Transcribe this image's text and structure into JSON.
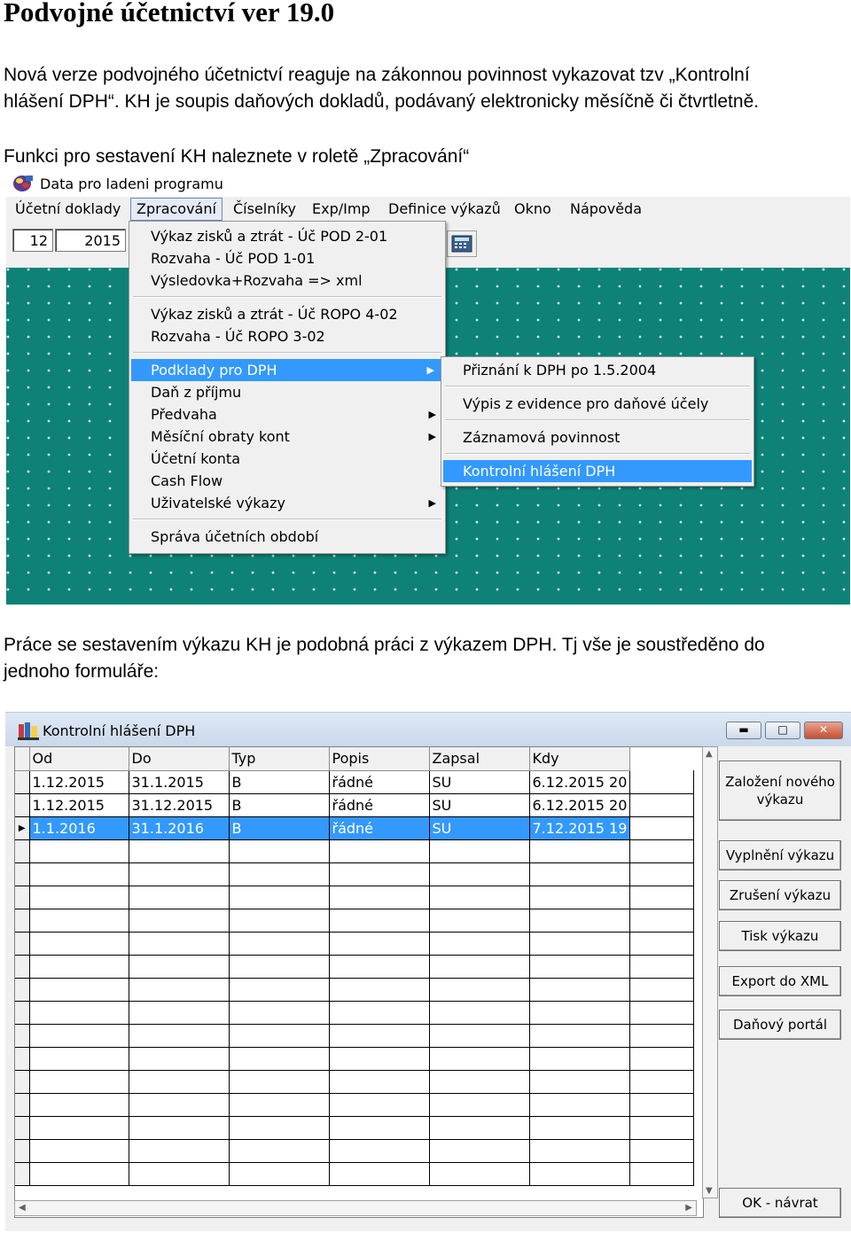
{
  "heading": "Podvojné účetnictví ver 19.0",
  "intro_line1": "Nová verze podvojného účetnictví reaguje na zákonnou povinnost vykazovat tzv „Kontrolní",
  "intro_line2": "hlášení DPH“. KH je soupis daňových dokladů, podávaný elektronicky měsíčně či čtvrtletně.",
  "menu_hint": "Funkci pro sestavení KH naleznete v roletě „Zpracování“",
  "work_line1": "Práce se sestavením výkazu KH je podobná práci z výkazem DPH. Tj vše je soustředěno do",
  "work_line2": "jednoho formuláře:",
  "app": {
    "title": "Data pro ladeni programu",
    "menubar": [
      "Účetní doklady",
      "Zpracování",
      "Číselníky",
      "Exp/Imp",
      "Definice výkazů",
      "Okno",
      "Nápověda"
    ],
    "month": "12",
    "year": "2015",
    "dropdown": [
      "Výkaz zisků a ztrát - Úč POD 2-01",
      "Rozvaha - Úč POD 1-01",
      "Výsledovka+Rozvaha => xml",
      "Výkaz zisků a ztrát - Úč ROPO 4-02",
      "Rozvaha - Úč ROPO 3-02",
      "Podklady pro DPH",
      "Daň z příjmu",
      "Předvaha",
      "Měsíční obraty kont",
      "Účetní konta",
      "Cash Flow",
      "Uživatelské výkazy",
      "Správa účetních období"
    ],
    "submenu": [
      "Přiznání k DPH po 1.5.2004",
      "Výpis z evidence pro daňové účely",
      "Záznamová povinnost",
      "Kontrolní hlášení DPH"
    ]
  },
  "kh": {
    "title": "Kontrolní hlášení DPH",
    "columns": [
      "Od",
      "Do",
      "Typ",
      "Popis",
      "Zapsal",
      "Kdy"
    ],
    "rows": [
      [
        "1.12.2015",
        "31.1.2015",
        "B",
        "řádné",
        "SU",
        "6.12.2015 20"
      ],
      [
        "1.12.2015",
        "31.12.2015",
        "B",
        "řádné",
        "SU",
        "6.12.2015 20"
      ],
      [
        "1.1.2016",
        "31.1.2016",
        "B",
        "řádné",
        "SU",
        "7.12.2015 19"
      ]
    ],
    "buttons": {
      "create_line1": "Založení nového",
      "create_line2": "výkazu",
      "fill": "Vyplnění výkazu",
      "cancel": "Zrušení výkazu",
      "print": "Tisk výkazu",
      "export": "Export do XML",
      "portal": "Daňový portál",
      "ok": "OK - návrat"
    }
  },
  "colors": {
    "desktop": "#0e8276",
    "highlight": "#3399ff"
  }
}
